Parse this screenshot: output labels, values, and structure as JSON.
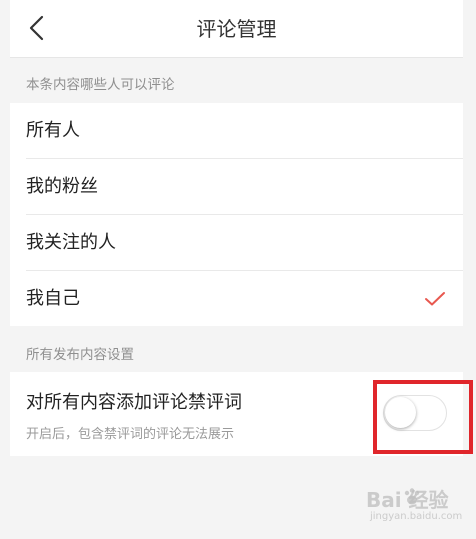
{
  "header": {
    "title": "评论管理",
    "back_icon": "chevron-left-icon"
  },
  "section1": {
    "label": "本条内容哪些人可以评论",
    "options": [
      {
        "label": "所有人",
        "selected": false
      },
      {
        "label": "我的粉丝",
        "selected": false
      },
      {
        "label": "我关注的人",
        "selected": false
      },
      {
        "label": "我自己",
        "selected": true
      }
    ],
    "check_icon": "checkmark-icon"
  },
  "section2": {
    "label": "所有发布内容设置",
    "setting": {
      "title": "对所有内容添加评论禁评词",
      "description": "开启后，包含禁评词的评论无法展示",
      "toggle_on": false
    }
  },
  "colors": {
    "accent": "#e8584f",
    "highlight": "#e0262b",
    "background": "#f4f4f4"
  },
  "watermark": {
    "main": "Bai 经验",
    "sub": "jingyan.baidu.com"
  }
}
